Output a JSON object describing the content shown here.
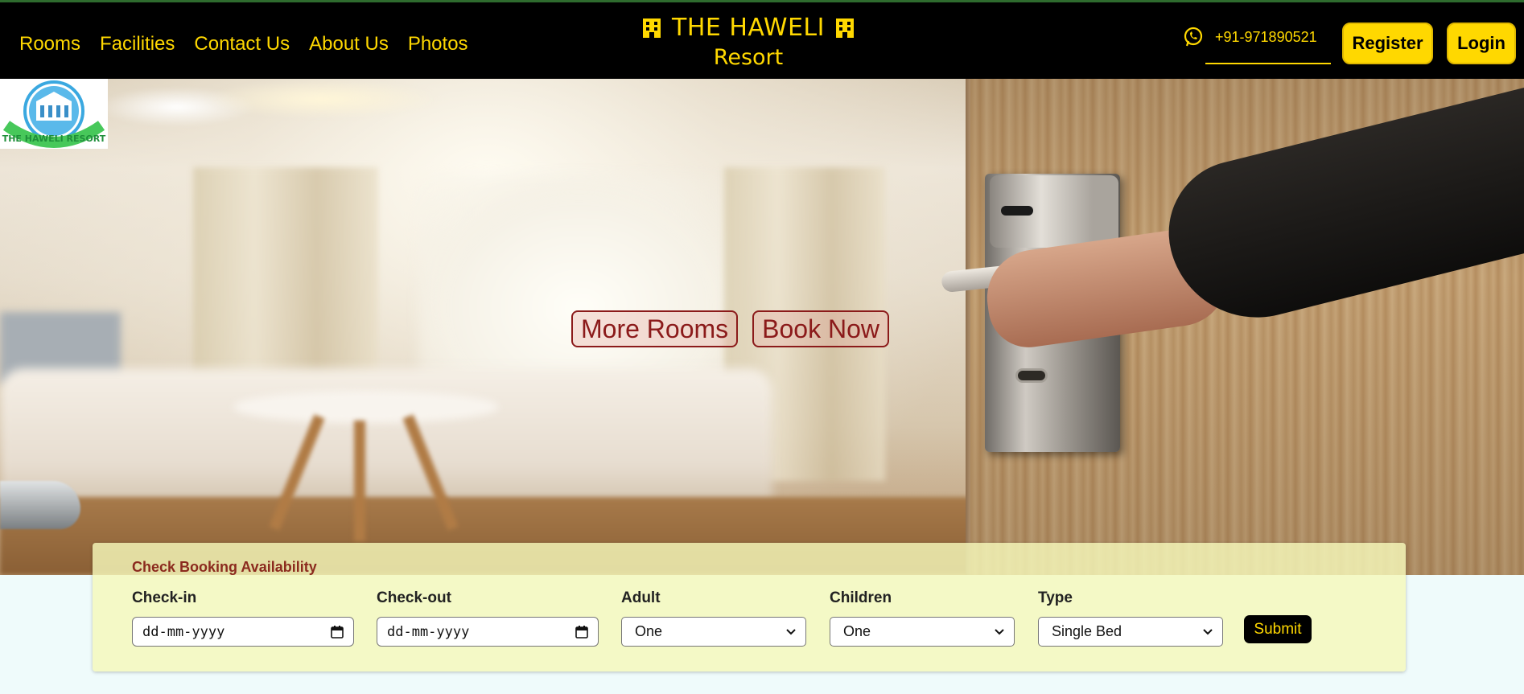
{
  "nav": {
    "links": [
      "Rooms",
      "Facilities",
      "Contact Us",
      "About Us",
      "Photos"
    ]
  },
  "brand": {
    "title": "THE HAWELI",
    "subtitle": "Resort",
    "icon": "hotel-building-icon"
  },
  "contact": {
    "phone": "+91-971890521",
    "icon": "whatsapp-icon"
  },
  "auth": {
    "register_label": "Register",
    "login_label": "Login"
  },
  "logo": {
    "text": "THE HAWELI RESORT"
  },
  "hero": {
    "more_rooms_label": "More Rooms",
    "book_now_label": "Book Now"
  },
  "booking": {
    "title": "Check Booking Availability",
    "checkin_label": "Check-in",
    "checkin_value": "dd-mm-yyyy",
    "checkout_label": "Check-out",
    "checkout_value": "dd-mm-yyyy",
    "adult_label": "Adult",
    "adult_value": "One",
    "children_label": "Children",
    "children_value": "One",
    "type_label": "Type",
    "type_value": "Single Bed",
    "submit_label": "Submit"
  },
  "colors": {
    "accent": "#ffd800",
    "navbar": "#000000",
    "hero_button": "#8b1a1a",
    "panel": "#f5f8b9"
  }
}
